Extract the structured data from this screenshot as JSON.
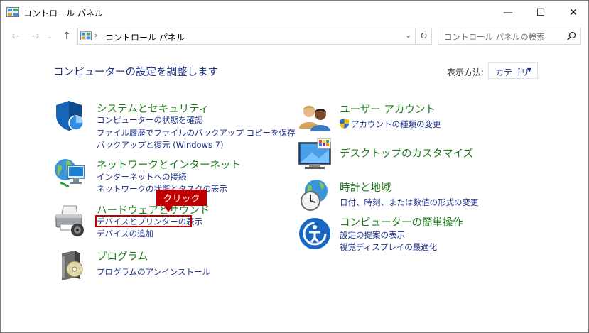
{
  "window": {
    "title": "コントロール パネル",
    "minimize": "—",
    "maximize": "☐",
    "close": "✕"
  },
  "nav": {
    "back": "←",
    "forward": "→",
    "recent": "⌄",
    "up": "↑"
  },
  "address": {
    "sep": "›",
    "path": "コントロール パネル",
    "dropdown": "⌄",
    "refresh": "↻"
  },
  "search": {
    "placeholder": "コントロール パネルの検索"
  },
  "main": {
    "heading": "コンピューターの設定を調整します",
    "view_by_label": "表示方法:",
    "view_by_value": "カテゴリ"
  },
  "categories": {
    "system": {
      "title": "システムとセキュリティ",
      "links": [
        "コンピューターの状態を確認",
        "ファイル履歴でファイルのバックアップ コピーを保存",
        "バックアップと復元 (Windows 7)"
      ]
    },
    "network": {
      "title": "ネットワークとインターネット",
      "links": [
        "インターネットへの接続",
        "ネットワークの状態とタスクの表示"
      ]
    },
    "hardware": {
      "title": "ハードウェアとサウンド",
      "links": [
        "デバイスとプリンターの表示",
        "デバイスの追加"
      ]
    },
    "programs": {
      "title": "プログラム",
      "links": [
        "プログラムのアンインストール"
      ]
    },
    "users": {
      "title": "ユーザー アカウント",
      "links": [
        "アカウントの種類の変更"
      ]
    },
    "appearance": {
      "title": "デスクトップのカスタマイズ"
    },
    "clock": {
      "title": "時計と地域",
      "links": [
        "日付、時刻、または数値の形式の変更"
      ]
    },
    "ease": {
      "title": "コンピューターの簡単操作",
      "links": [
        "設定の提案の表示",
        "視覚ディスプレイの最適化"
      ]
    }
  },
  "annotation": {
    "callout": "クリック"
  },
  "colors": {
    "link": "#1e3287",
    "category_title": "#1e7b1e",
    "annotation": "#c00000"
  }
}
